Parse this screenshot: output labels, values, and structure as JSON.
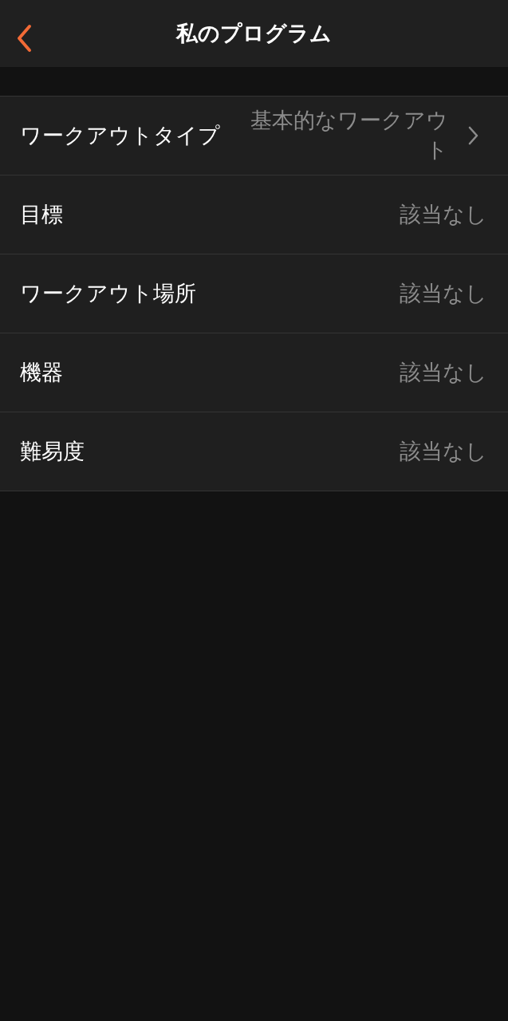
{
  "header": {
    "title": "私のプログラム"
  },
  "rows": [
    {
      "label": "ワークアウトタイプ",
      "value": "基本的なワークアウト",
      "disclosure": true
    },
    {
      "label": "目標",
      "value": "該当なし",
      "disclosure": false
    },
    {
      "label": "ワークアウト場所",
      "value": "該当なし",
      "disclosure": false
    },
    {
      "label": "機器",
      "value": "該当なし",
      "disclosure": false
    },
    {
      "label": "難易度",
      "value": "該当なし",
      "disclosure": false
    }
  ]
}
